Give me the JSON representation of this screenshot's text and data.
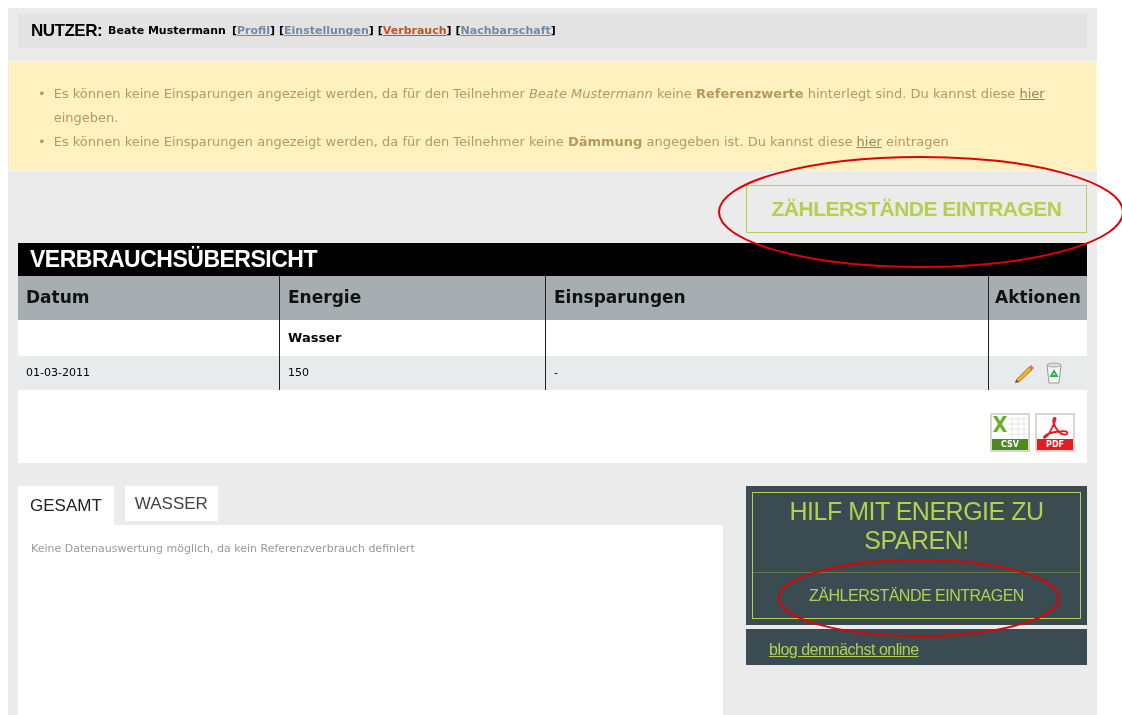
{
  "user_bar": {
    "label": "NUTZER:",
    "user": "Beate Mustermann",
    "links": [
      {
        "prefix": "[",
        "label": "Profil",
        "suffix": "]",
        "selected": false
      },
      {
        "prefix": "[",
        "label": "Einstellungen",
        "suffix": "]",
        "selected": false
      },
      {
        "prefix": "[",
        "label": "Verbrauch",
        "suffix": "]",
        "selected": true
      },
      {
        "prefix": "[",
        "label": "Nachbarschaft",
        "suffix": "]",
        "selected": false
      }
    ]
  },
  "notices": [
    {
      "bullet": "•",
      "before": "Es können keine Einsparungen angezeigt werden, da für den Teilnehmer *Beate Mustermann* keine **Referenzwerte** hinterlegt sind. Du kannst diese ",
      "link": "hier",
      "after": " eingeben."
    },
    {
      "bullet": "•",
      "before": "Es können keine Einsparungen angezeigt werden, da für den Teilnehmer keine **Dämmung** angegeben ist. Du kannst diese ",
      "link": "hier",
      "after": " eintragen"
    }
  ],
  "primary_button": "ZÄHLERSTÄNDE EINTRAGEN",
  "table": {
    "title": "VERBRAUCHSÜBERSICHT",
    "columns": [
      "Datum",
      "Energie",
      "Einsparungen",
      "Aktionen"
    ],
    "rows": [
      {
        "kind": "group",
        "label": "Wasser"
      },
      {
        "kind": "entry",
        "date": "01-03-2011",
        "energy": "150",
        "savings": "-"
      }
    ],
    "exports": [
      {
        "kind": "csv",
        "label": "CSV"
      },
      {
        "kind": "pdf",
        "label": "PDF"
      }
    ]
  },
  "tabs": [
    {
      "label": "GESAMT",
      "selected": true
    },
    {
      "label": "WASSER",
      "selected": false
    }
  ],
  "tab_panel": {
    "message": "Keine Datenauswertung möglich, da kein Referenzverbrauch definiert"
  },
  "sidebar": {
    "title": "HILF MIT ENERGIE ZU SPAREN!",
    "button": "ZÄHLERSTÄNDE EINTRAGEN",
    "blog_link": "blog demnächst online"
  }
}
